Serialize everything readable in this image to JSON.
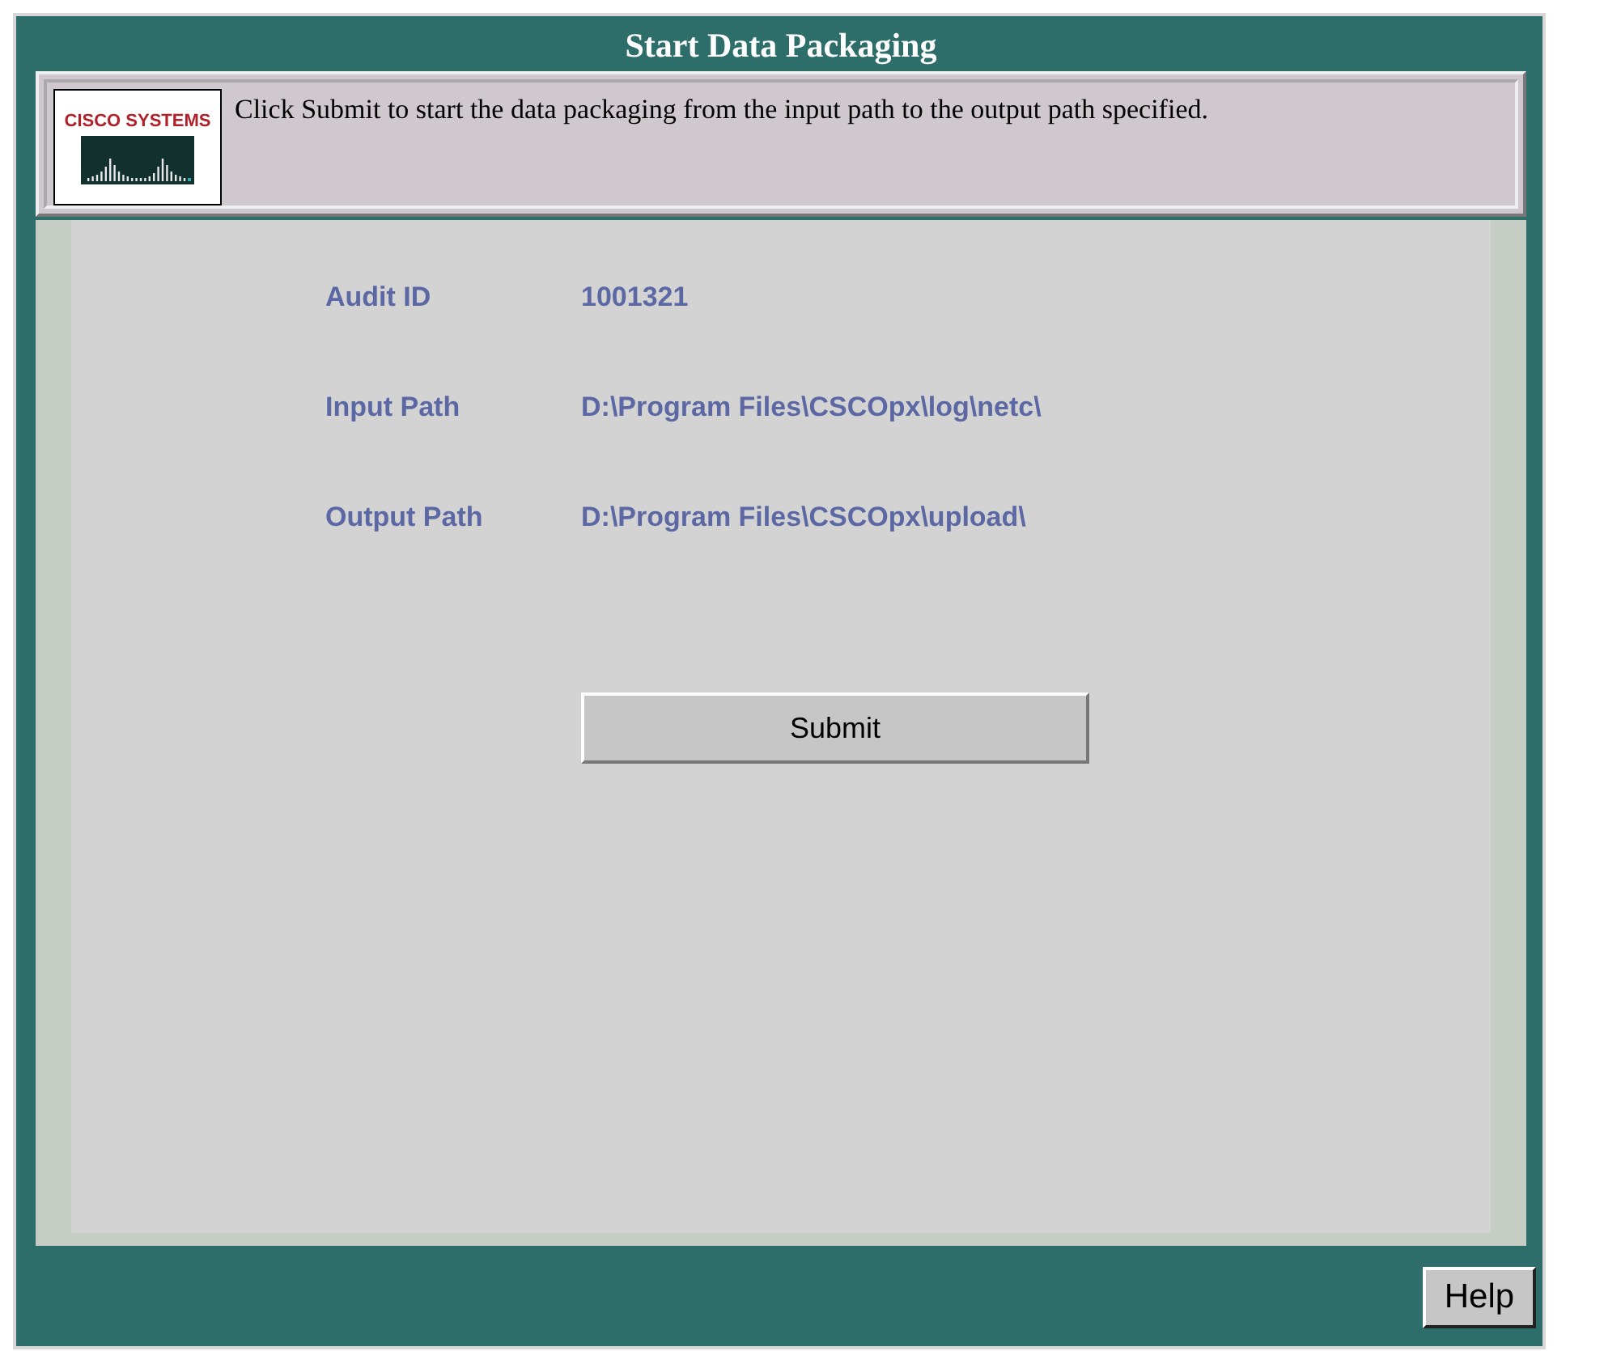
{
  "window": {
    "title": "Start Data Packaging"
  },
  "header": {
    "logo_text": "CISCO SYSTEMS",
    "message": "Click Submit to start the data packaging from the input path to the output path specified."
  },
  "fields": [
    {
      "label": "Audit ID",
      "value": "1001321"
    },
    {
      "label": "Input Path",
      "value": "D:\\Program Files\\CSCOpx\\log\\netc\\"
    },
    {
      "label": "Output Path",
      "value": "D:\\Program Files\\CSCOpx\\upload\\"
    }
  ],
  "buttons": {
    "submit": "Submit",
    "help": "Help"
  }
}
